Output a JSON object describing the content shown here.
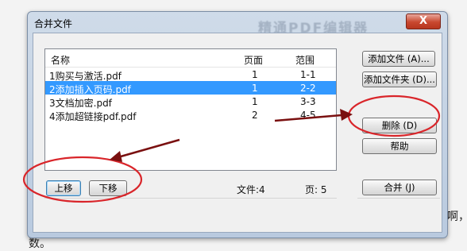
{
  "dialog": {
    "title": "合并文件",
    "watermark": "精通PDF编辑器",
    "close_label": "X"
  },
  "list": {
    "columns": [
      "名称",
      "页面",
      "范围"
    ],
    "rows": [
      {
        "name": "1购买与激活.pdf",
        "pages": "1",
        "range": "1-1",
        "selected": false
      },
      {
        "name": "2添加插入页码.pdf",
        "pages": "1",
        "range": "2-2",
        "selected": true
      },
      {
        "name": "3文档加密.pdf",
        "pages": "1",
        "range": "3-3",
        "selected": false
      },
      {
        "name": "4添加超链接pdf.pdf",
        "pages": "2",
        "range": "4-5",
        "selected": false
      }
    ]
  },
  "buttons": {
    "add_file": "添加文件 (A)...",
    "add_folder": "添加文件夹 (D)...",
    "delete": "删除 (D)",
    "help": "帮助",
    "merge": "合并 (J)",
    "move_up": "上移",
    "move_down": "下移"
  },
  "summary": {
    "files": "文件:4",
    "pages": "页: 5"
  },
  "background": {
    "right_char": "啊，",
    "bottom_char": "数。"
  },
  "annotations": {
    "color": "#d9252a",
    "arrow_color": "#7a1010"
  }
}
